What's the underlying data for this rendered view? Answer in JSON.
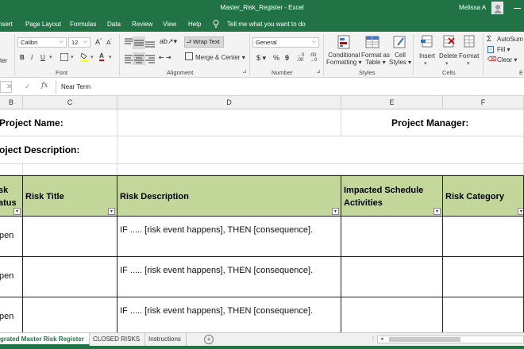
{
  "window": {
    "title": "Master_Risk_Register  -  Excel",
    "user": "Melissa A"
  },
  "ribbon_tabs": [
    "nsert",
    "Page Layout",
    "Formulas",
    "Data",
    "Review",
    "View",
    "Help",
    "Tell me what you want to do"
  ],
  "ribbon": {
    "font_name": "Calibri",
    "font_size": "12",
    "grow_font": "A",
    "shrink_font": "A",
    "bold": "B",
    "italic": "I",
    "underline": "U",
    "font_color": "A",
    "wrap_text": "Wrap Text",
    "merge_center": "Merge & Center",
    "number_format": "General",
    "currency": "$",
    "percent": "%",
    "comma": "9",
    "cond_format": [
      "Conditional",
      "Formatting"
    ],
    "format_as_table": [
      "Format as",
      "Table"
    ],
    "cell_styles": [
      "Cell",
      "Styles"
    ],
    "insert": "Insert",
    "delete": "Delete",
    "format": "Format",
    "autosum": "AutoSum",
    "fill": "Fill",
    "clear": "Clear",
    "groups": {
      "clipboard_tail": "ter",
      "font": "Font",
      "alignment": "Alignment",
      "number": "Number",
      "styles": "Styles",
      "cells": "Cells",
      "editing": "E"
    }
  },
  "formula_bar": {
    "fx": "fx",
    "value": "Near Term"
  },
  "columns": [
    "B",
    "C",
    "D",
    "E",
    "F"
  ],
  "sheet": {
    "project_name_label": "Project Name:",
    "project_manager_label": "Project Manager:",
    "project_description_label": "oject Description:",
    "table_headers": {
      "risk_status": [
        "sk",
        "atus"
      ],
      "risk_title": "Risk Title",
      "risk_description": "Risk Description",
      "impacted_activities": [
        "Impacted Schedule",
        "Activities"
      ],
      "risk_category": "Risk Category"
    },
    "rows": [
      {
        "status": "pen",
        "description": "IF .....  [risk event happens], THEN [consequence]."
      },
      {
        "status": "pen",
        "description": "IF .....  [risk event happens], THEN [consequence]."
      },
      {
        "status": "pen",
        "description": "IF .....  [risk event happens], THEN [consequence]."
      }
    ]
  },
  "sheet_tabs": [
    "grated Master Risk Register",
    "CLOSED RISKS",
    "Instructions"
  ],
  "colors": {
    "excel_green": "#217346",
    "header_fill": "#c4d79b"
  }
}
